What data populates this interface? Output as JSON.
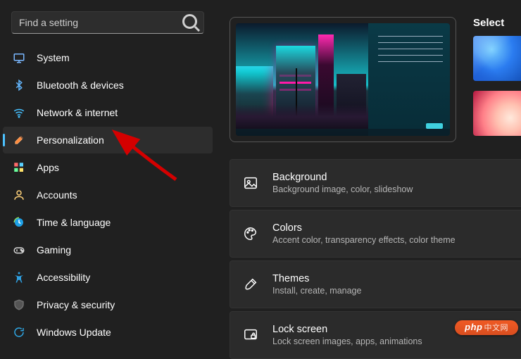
{
  "search": {
    "placeholder": "Find a setting"
  },
  "sidebar": {
    "items": [
      {
        "label": "System"
      },
      {
        "label": "Bluetooth & devices"
      },
      {
        "label": "Network & internet"
      },
      {
        "label": "Personalization"
      },
      {
        "label": "Apps"
      },
      {
        "label": "Accounts"
      },
      {
        "label": "Time & language"
      },
      {
        "label": "Gaming"
      },
      {
        "label": "Accessibility"
      },
      {
        "label": "Privacy & security"
      },
      {
        "label": "Windows Update"
      }
    ],
    "activeIndex": 3
  },
  "preview": {
    "selectLabel": "Select"
  },
  "options": [
    {
      "title": "Background",
      "desc": "Background image, color, slideshow"
    },
    {
      "title": "Colors",
      "desc": "Accent color, transparency effects, color theme"
    },
    {
      "title": "Themes",
      "desc": "Install, create, manage"
    },
    {
      "title": "Lock screen",
      "desc": "Lock screen images, apps, animations"
    }
  ],
  "watermark": {
    "brand": "php",
    "suffix": "中文网"
  }
}
